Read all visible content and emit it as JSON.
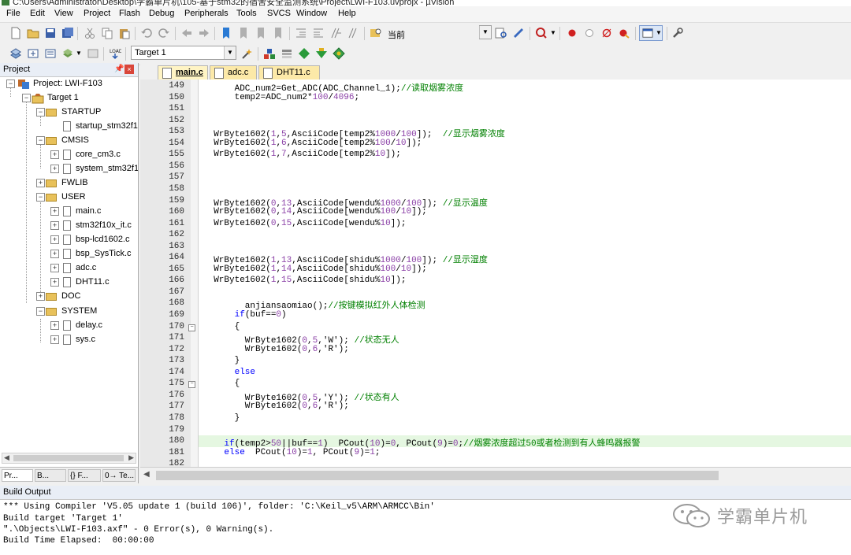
{
  "window_title": "C:\\Users\\Administrator\\Desktop\\学霸单片机\\105-基于stm32的宿舍安全监测系统\\Project\\LWI-F103.uvprojx - µVision",
  "menu": [
    "File",
    "Edit",
    "View",
    "Project",
    "Flash",
    "Debug",
    "Peripherals",
    "Tools",
    "SVCS",
    "Window",
    "Help"
  ],
  "toolbar": {
    "search_combo": "当前"
  },
  "toolbar2": {
    "target_combo": "Target 1"
  },
  "project_panel": {
    "title": "Project",
    "root": "Project: LWI-F103",
    "target": "Target 1",
    "groups": {
      "startup": {
        "name": "STARTUP",
        "files": [
          "startup_stm32f1"
        ]
      },
      "cmsis": {
        "name": "CMSIS",
        "files": [
          "core_cm3.c",
          "system_stm32f1"
        ]
      },
      "fwlib": {
        "name": "FWLIB"
      },
      "user": {
        "name": "USER",
        "files": [
          "main.c",
          "stm32f10x_it.c",
          "bsp-lcd1602.c",
          "bsp_SysTick.c",
          "adc.c",
          "DHT11.c"
        ]
      },
      "doc": {
        "name": "DOC"
      },
      "system": {
        "name": "SYSTEM",
        "files": [
          "delay.c",
          "sys.c"
        ]
      }
    },
    "bottom_tabs": [
      "Pr...",
      "B...",
      "{} F...",
      "0→ Te..."
    ]
  },
  "editor_tabs": [
    "main.c",
    "adc.c",
    "DHT11.c"
  ],
  "code_lines": [
    {
      "n": "149",
      "text": "      ADC_num2=Get_ADC(ADC_Channel_1);//读取烟雾浓度"
    },
    {
      "n": "150",
      "text": "      temp2=ADC_num2*100/4096;"
    },
    {
      "n": "151",
      "text": ""
    },
    {
      "n": "152",
      "text": ""
    },
    {
      "n": "153",
      "text": "  WrByte1602(1,5,AsciiCode[temp2%1000/100]);  //显示烟雾浓度"
    },
    {
      "n": "154",
      "text": "  WrByte1602(1,6,AsciiCode[temp2%100/10]);"
    },
    {
      "n": "155",
      "text": "  WrByte1602(1,7,AsciiCode[temp2%10]);"
    },
    {
      "n": "156",
      "text": ""
    },
    {
      "n": "157",
      "text": ""
    },
    {
      "n": "158",
      "text": ""
    },
    {
      "n": "159",
      "text": "  WrByte1602(0,13,AsciiCode[wendu%1000/100]); //显示温度"
    },
    {
      "n": "160",
      "text": "  WrByte1602(0,14,AsciiCode[wendu%100/10]);"
    },
    {
      "n": "161",
      "text": "  WrByte1602(0,15,AsciiCode[wendu%10]);"
    },
    {
      "n": "162",
      "text": ""
    },
    {
      "n": "163",
      "text": ""
    },
    {
      "n": "164",
      "text": "  WrByte1602(1,13,AsciiCode[shidu%1000/100]); //显示湿度"
    },
    {
      "n": "165",
      "text": "  WrByte1602(1,14,AsciiCode[shidu%100/10]);"
    },
    {
      "n": "166",
      "text": "  WrByte1602(1,15,AsciiCode[shidu%10]);"
    },
    {
      "n": "167",
      "text": ""
    },
    {
      "n": "168",
      "text": "        anjiansaomiao();//按键模拟红外人体检测"
    },
    {
      "n": "169",
      "text": "      if(buf==0)"
    },
    {
      "n": "170",
      "text": "      {"
    },
    {
      "n": "171",
      "text": "        WrByte1602(0,5,'W'); //状态无人"
    },
    {
      "n": "172",
      "text": "        WrByte1602(0,6,'R');"
    },
    {
      "n": "173",
      "text": "      }"
    },
    {
      "n": "174",
      "text": "      else"
    },
    {
      "n": "175",
      "text": "      {"
    },
    {
      "n": "176",
      "text": "        WrByte1602(0,5,'Y'); //状态有人"
    },
    {
      "n": "177",
      "text": "        WrByte1602(0,6,'R');"
    },
    {
      "n": "178",
      "text": "      }"
    },
    {
      "n": "179",
      "text": ""
    },
    {
      "n": "180",
      "text": "    if(temp2>50||buf==1)  PCout(10)=0, PCout(9)=0;//烟雾浓度超过50或者检测到有人蜂鸣器报警"
    },
    {
      "n": "181",
      "text": "    else  PCout(10)=1, PCout(9)=1;"
    },
    {
      "n": "182",
      "text": ""
    }
  ],
  "build_output": {
    "title": "Build Output",
    "lines": [
      "*** Using Compiler 'V5.05 update 1 (build 106)', folder: 'C:\\Keil_v5\\ARM\\ARMCC\\Bin'",
      "Build target 'Target 1'",
      "\".\\Objects\\LWI-F103.axf\" - 0 Error(s), 0 Warning(s).",
      "Build Time Elapsed:  00:00:00"
    ]
  },
  "watermark": "学霸单片机"
}
